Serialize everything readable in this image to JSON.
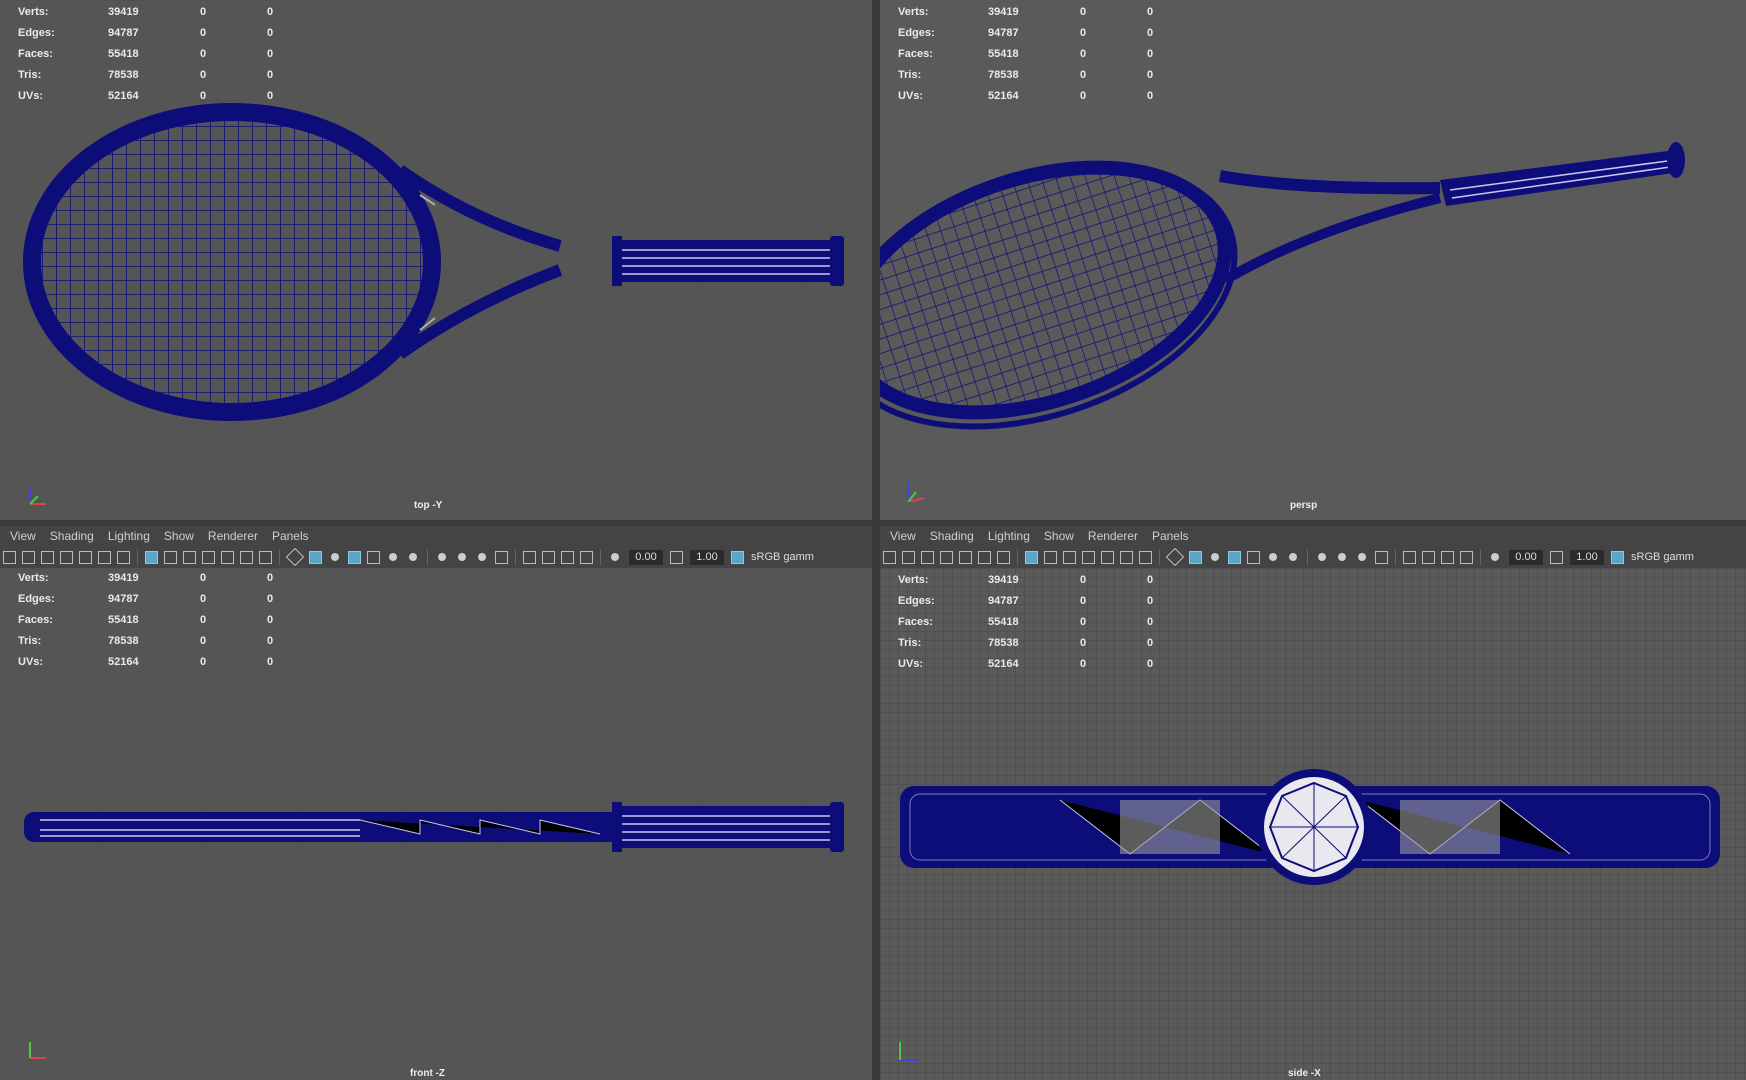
{
  "stats_labels": [
    "Verts:",
    "Edges:",
    "Faces:",
    "Tris:",
    "UVs:"
  ],
  "stats": [
    [
      "39419",
      "0",
      "0"
    ],
    [
      "94787",
      "0",
      "0"
    ],
    [
      "55418",
      "0",
      "0"
    ],
    [
      "78538",
      "0",
      "0"
    ],
    [
      "52164",
      "0",
      "0"
    ]
  ],
  "viewports": {
    "top": {
      "camera": "top -Y"
    },
    "persp": {
      "camera": "persp"
    },
    "front": {
      "camera": "front -Z"
    },
    "side": {
      "camera": "side -X"
    }
  },
  "menu": [
    "View",
    "Shading",
    "Lighting",
    "Show",
    "Renderer",
    "Panels"
  ],
  "toolbar": {
    "exposure": "0.00",
    "gamma": "1.00",
    "color_space": "sRGB gamm"
  },
  "colors": {
    "wire": "#0d0d7a",
    "wire_light": "#9a9ad8",
    "viewport_bg": "#585858",
    "active_icon": "#5aa6c8"
  },
  "icons": [
    "camera-select-icon",
    "camera-attributes-icon",
    "bookmark-icon",
    "image-plane-icon",
    "grid-icon",
    "film-gate-icon",
    "wireframe-icon",
    "smooth-shade-icon",
    "textured-icon",
    "lighting-icon",
    "shadows-icon",
    "isolate-icon",
    "xray-icon",
    "exposure-icon",
    "gamma-icon",
    "color-management-icon"
  ]
}
